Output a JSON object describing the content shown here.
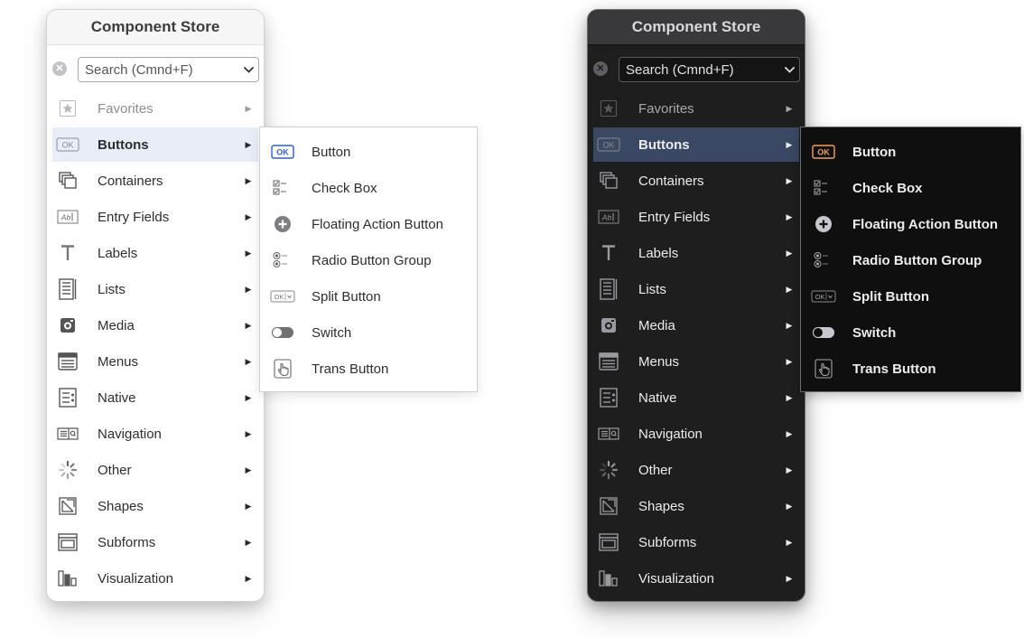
{
  "light_panel": {
    "title": "Component Store",
    "search": {
      "placeholder": "Search (Cmnd+F)"
    },
    "categories": [
      {
        "label": "Favorites",
        "icon": "star-icon"
      },
      {
        "label": "Buttons",
        "icon": "ok-button-icon"
      },
      {
        "label": "Containers",
        "icon": "containers-icon"
      },
      {
        "label": "Entry Fields",
        "icon": "entry-field-icon"
      },
      {
        "label": "Labels",
        "icon": "text-t-icon"
      },
      {
        "label": "Lists",
        "icon": "list-icon"
      },
      {
        "label": "Media",
        "icon": "camera-icon"
      },
      {
        "label": "Menus",
        "icon": "menu-icon"
      },
      {
        "label": "Native",
        "icon": "native-icon"
      },
      {
        "label": "Navigation",
        "icon": "navigation-icon"
      },
      {
        "label": "Other",
        "icon": "spinner-icon"
      },
      {
        "label": "Shapes",
        "icon": "shapes-icon"
      },
      {
        "label": "Subforms",
        "icon": "subform-icon"
      },
      {
        "label": "Visualization",
        "icon": "bar-chart-icon"
      }
    ],
    "selected": "Buttons",
    "dimmed": "Favorites",
    "accent": "#2c5fd6"
  },
  "dark_panel": {
    "title": "Component Store",
    "search": {
      "placeholder": "Search (Cmnd+F)"
    },
    "categories": [
      {
        "label": "Favorites",
        "icon": "star-icon"
      },
      {
        "label": "Buttons",
        "icon": "ok-button-icon"
      },
      {
        "label": "Containers",
        "icon": "containers-icon"
      },
      {
        "label": "Entry Fields",
        "icon": "entry-field-icon"
      },
      {
        "label": "Labels",
        "icon": "text-t-icon"
      },
      {
        "label": "Lists",
        "icon": "list-icon"
      },
      {
        "label": "Media",
        "icon": "camera-icon"
      },
      {
        "label": "Menus",
        "icon": "menu-icon"
      },
      {
        "label": "Native",
        "icon": "native-icon"
      },
      {
        "label": "Navigation",
        "icon": "navigation-icon"
      },
      {
        "label": "Other",
        "icon": "spinner-icon"
      },
      {
        "label": "Shapes",
        "icon": "shapes-icon"
      },
      {
        "label": "Subforms",
        "icon": "subform-icon"
      },
      {
        "label": "Visualization",
        "icon": "bar-chart-icon"
      }
    ],
    "selected": "Buttons",
    "dimmed": "Favorites",
    "accent": "#f0a060"
  },
  "light_submenu": {
    "items": [
      {
        "label": "Button",
        "icon": "ok-button-icon"
      },
      {
        "label": "Check Box",
        "icon": "checkbox-icon"
      },
      {
        "label": "Floating Action Button",
        "icon": "plus-circle-icon"
      },
      {
        "label": "Radio Button Group",
        "icon": "radio-group-icon"
      },
      {
        "label": "Split Button",
        "icon": "split-button-icon"
      },
      {
        "label": "Switch",
        "icon": "toggle-switch-icon"
      },
      {
        "label": "Trans Button",
        "icon": "hand-pointer-icon"
      }
    ]
  },
  "dark_submenu": {
    "items": [
      {
        "label": "Button",
        "icon": "ok-button-icon"
      },
      {
        "label": "Check Box",
        "icon": "checkbox-icon"
      },
      {
        "label": "Floating Action Button",
        "icon": "plus-circle-icon"
      },
      {
        "label": "Radio Button Group",
        "icon": "radio-group-icon"
      },
      {
        "label": "Split Button",
        "icon": "split-button-icon"
      },
      {
        "label": "Switch",
        "icon": "toggle-switch-icon"
      },
      {
        "label": "Trans Button",
        "icon": "hand-pointer-icon"
      }
    ]
  }
}
